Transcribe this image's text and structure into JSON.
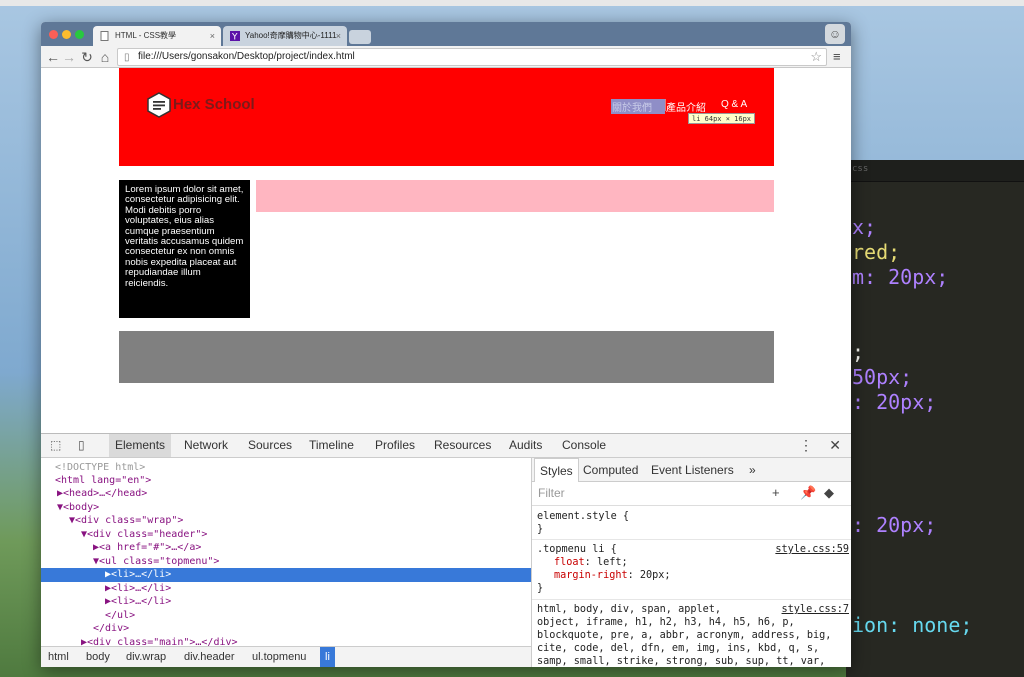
{
  "browser": {
    "tabs": [
      {
        "title": "HTML - CSS教學",
        "close": "×"
      },
      {
        "title": "Yahoo!奇摩購物中心-1111",
        "close": "×"
      }
    ],
    "url": "file:///Users/gonsakon/Desktop/project/index.html",
    "icons": {
      "back": "left-arrow-icon",
      "forward": "right-arrow-icon",
      "reload": "reload-icon",
      "home": "home-icon",
      "star": "star-icon",
      "menu": "hamburger-icon"
    }
  },
  "page": {
    "logo_text": "Hex School",
    "menu": [
      "關於我們",
      "產品介紹",
      "Q & A"
    ],
    "inspect_tooltip": "li 64px × 16px",
    "lorem": "Lorem ipsum dolor sit amet, consectetur adipisicing elit. Modi debitis porro voluptates, eius alias cumque praesentium veritatis accusamus quidem consectetur ex non omnis nobis expedita placeat aut repudiandae illum reiciendis.",
    "colors": {
      "header": "#ff0000",
      "pink": "#ffb6c1",
      "footer": "#808080",
      "sidebar": "#000000"
    }
  },
  "devtools": {
    "tabs": [
      "Elements",
      "Network",
      "Sources",
      "Timeline",
      "Profiles",
      "Resources",
      "Audits",
      "Console"
    ],
    "active_tab": "Elements",
    "dom": [
      "<!DOCTYPE html>",
      "<html lang=\"en\">",
      "▶<head>…</head>",
      "▼<body>",
      "▼<div class=\"wrap\">",
      "▼<div class=\"header\">",
      "▶<a href=\"#\">…</a>",
      "▼<ul class=\"topmenu\">",
      "▶<li>…</li>",
      "▶<li>…</li>",
      "▶<li>…</li>",
      "</ul>",
      "</div>",
      "▶<div class=\"main\">…</div>"
    ],
    "breadcrumbs": [
      "html",
      "body",
      "div.wrap",
      "div.header",
      "ul.topmenu",
      "li"
    ],
    "styles_tabs": [
      "Styles",
      "Computed",
      "Event Listeners",
      "»"
    ],
    "filter_placeholder": "Filter",
    "rules": {
      "element_style": "element.style {",
      "topmenu_selector": ".topmenu li {",
      "topmenu_src": "style.css:59",
      "decl1_prop": "float",
      "decl1_val": "left;",
      "decl2_prop": "margin-right",
      "decl2_val": "20px;",
      "close": "}",
      "reset_src": "style.css:7",
      "reset_lines": [
        "html, body, div, span, applet,",
        "object, iframe, h1, h2, h3, h4, h5, h6, p,",
        "blockquote, pre, a, abbr, acronym, address, big,",
        "cite, code, del, dfn, em, img, ins, kbd, q, s,",
        "samp, small, strike, strong, sub, sup, tt, var,"
      ]
    }
  },
  "editor": {
    "lines": [
      "x;",
      "red;",
      "m: 20px;",
      ";",
      "50px;",
      ": 20px;",
      ": 20px;",
      "ion: none;"
    ]
  }
}
